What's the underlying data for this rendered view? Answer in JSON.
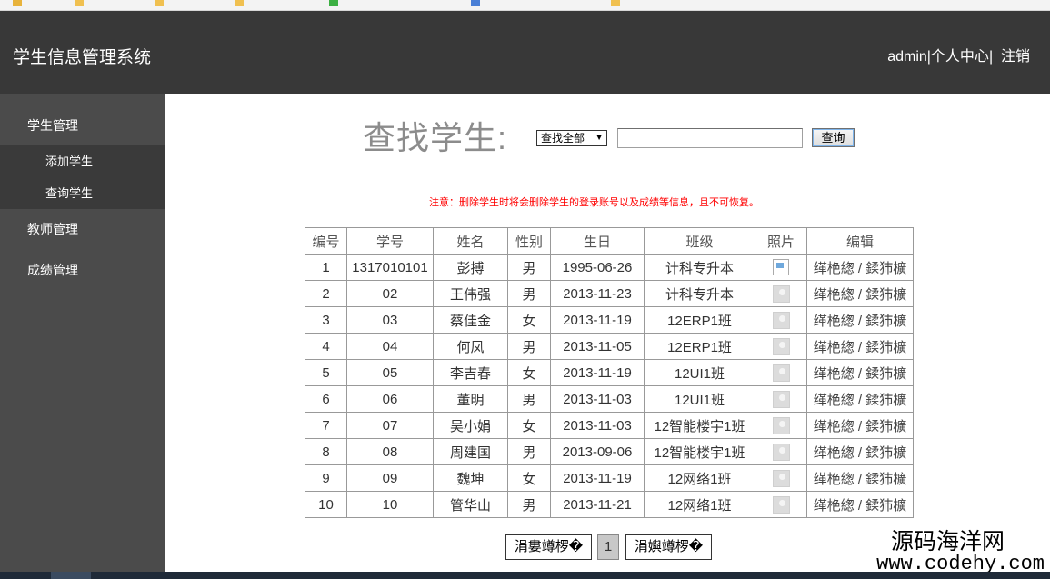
{
  "app": {
    "title": "学生信息管理系统"
  },
  "user_nav": {
    "username": "admin",
    "sep1": "|",
    "profile": "个人中心",
    "sep2": "|",
    "logout": "注销"
  },
  "sidebar": {
    "student_group": "学生管理",
    "student_sub": [
      "添加学生",
      "查询学生"
    ],
    "teacher": "教师管理",
    "grades": "成绩管理"
  },
  "search": {
    "title": "查找学生:",
    "select_value": "查找全部",
    "input_value": "",
    "button": "查询"
  },
  "notice": "注意：删除学生时将会删除学生的登录账号以及成绩等信息，且不可恢复。",
  "table": {
    "headers": [
      "编号",
      "学号",
      "姓名",
      "性别",
      "生日",
      "班级",
      "照片",
      "编辑"
    ],
    "rows": [
      [
        "1",
        "1317010101",
        "彭搏",
        "男",
        "1995-06-26",
        "计科专升本",
        "broken",
        "缂栬緫 / 鍒犻櫎"
      ],
      [
        "2",
        "02",
        "王伟强",
        "男",
        "2013-11-23",
        "计科专升本",
        "placeholder",
        "缂栬緫 / 鍒犻櫎"
      ],
      [
        "3",
        "03",
        "蔡佳金",
        "女",
        "2013-11-19",
        "12ERP1班",
        "placeholder",
        "缂栬緫 / 鍒犻櫎"
      ],
      [
        "4",
        "04",
        "何凤",
        "男",
        "2013-11-05",
        "12ERP1班",
        "placeholder",
        "缂栬緫 / 鍒犻櫎"
      ],
      [
        "5",
        "05",
        "李吉春",
        "女",
        "2013-11-19",
        "12UI1班",
        "placeholder",
        "缂栬緫 / 鍒犻櫎"
      ],
      [
        "6",
        "06",
        "董明",
        "男",
        "2013-11-03",
        "12UI1班",
        "placeholder",
        "缂栬緫 / 鍒犻櫎"
      ],
      [
        "7",
        "07",
        "吴小娟",
        "女",
        "2013-11-03",
        "12智能楼宇1班",
        "placeholder",
        "缂栬緫 / 鍒犻櫎"
      ],
      [
        "8",
        "08",
        "周建国",
        "男",
        "2013-09-06",
        "12智能楼宇1班",
        "placeholder",
        "缂栬緫 / 鍒犻櫎"
      ],
      [
        "9",
        "09",
        "魏坤",
        "女",
        "2013-11-19",
        "12网络1班",
        "placeholder",
        "缂栬緫 / 鍒犻櫎"
      ],
      [
        "10",
        "10",
        "管华山",
        "男",
        "2013-11-21",
        "12网络1班",
        "placeholder",
        "缂栬緫 / 鍒犻櫎"
      ]
    ]
  },
  "pagination": {
    "prev": "涓婁竴椤�",
    "current": "1",
    "next": "涓嬩竴椤�"
  },
  "watermark": {
    "cn": "源码海洋网",
    "url": "www.codehy.com"
  },
  "colors": {
    "header_bg": "#383838",
    "sidebar_bg": "#4b4b4b",
    "sidebar_sub_bg": "#3a3a3a",
    "notice": "#ff0000"
  }
}
